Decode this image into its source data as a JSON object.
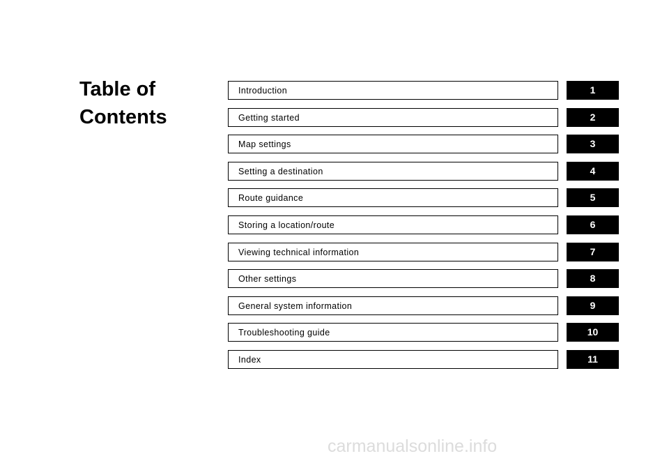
{
  "document": {
    "title_line1": "Table of",
    "title_line2": "Contents",
    "watermark": "carmanualsonline.info"
  },
  "contents": [
    {
      "label": "Introduction",
      "tab": "1"
    },
    {
      "label": "Getting started",
      "tab": "2"
    },
    {
      "label": "Map settings",
      "tab": "3"
    },
    {
      "label": "Setting a destination",
      "tab": "4"
    },
    {
      "label": "Route guidance",
      "tab": "5"
    },
    {
      "label": "Storing a location/route",
      "tab": "6"
    },
    {
      "label": "Viewing technical information",
      "tab": "7"
    },
    {
      "label": "Other settings",
      "tab": "8"
    },
    {
      "label": "General system information",
      "tab": "9"
    },
    {
      "label": "Troubleshooting guide",
      "tab": "10"
    },
    {
      "label": "Index",
      "tab": "11"
    }
  ],
  "colors": {
    "tab_background": "#000000",
    "tab_text": "#ffffff",
    "border": "#000000",
    "page_background": "#ffffff",
    "watermark": "#dcdcdc"
  }
}
